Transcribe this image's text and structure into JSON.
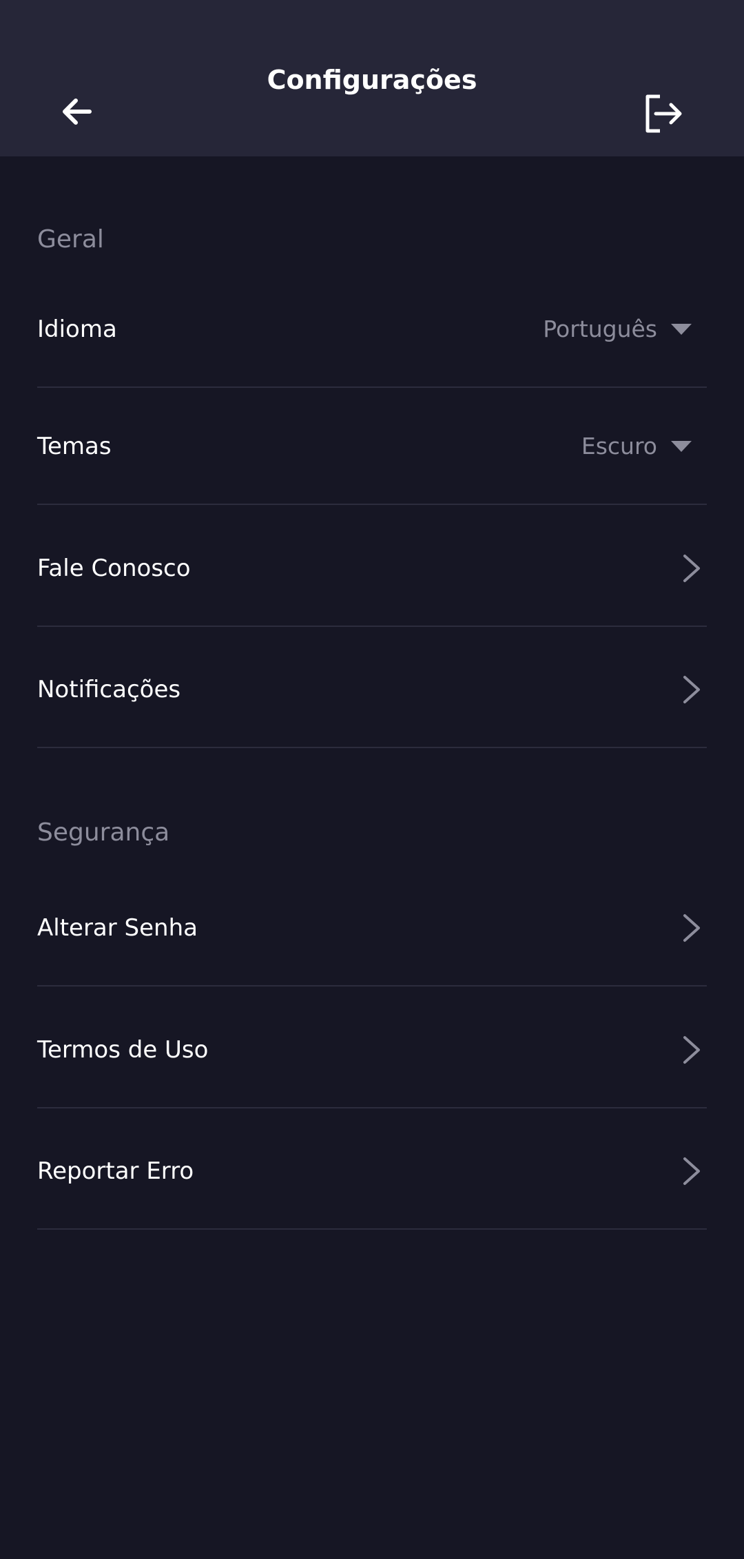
{
  "header": {
    "title": "Configurações",
    "back_icon": "arrow-left-icon",
    "logout_icon": "logout-icon"
  },
  "sections": {
    "general": {
      "title": "Geral",
      "items": [
        {
          "label": "Idioma",
          "value": "Português",
          "type": "dropdown"
        },
        {
          "label": "Temas",
          "value": "Escuro",
          "type": "dropdown"
        },
        {
          "label": "Fale Conosco",
          "type": "link"
        },
        {
          "label": "Notificações",
          "type": "link"
        }
      ]
    },
    "security": {
      "title": "Segurança",
      "items": [
        {
          "label": "Alterar Senha",
          "type": "link"
        },
        {
          "label": "Termos de Uso",
          "type": "link"
        },
        {
          "label": "Reportar Erro",
          "type": "link"
        }
      ]
    }
  },
  "colors": {
    "background": "#161624",
    "header": "#262638",
    "text": "#ffffff",
    "muted": "#8d8d9c",
    "divider": "#2c2c3d"
  }
}
